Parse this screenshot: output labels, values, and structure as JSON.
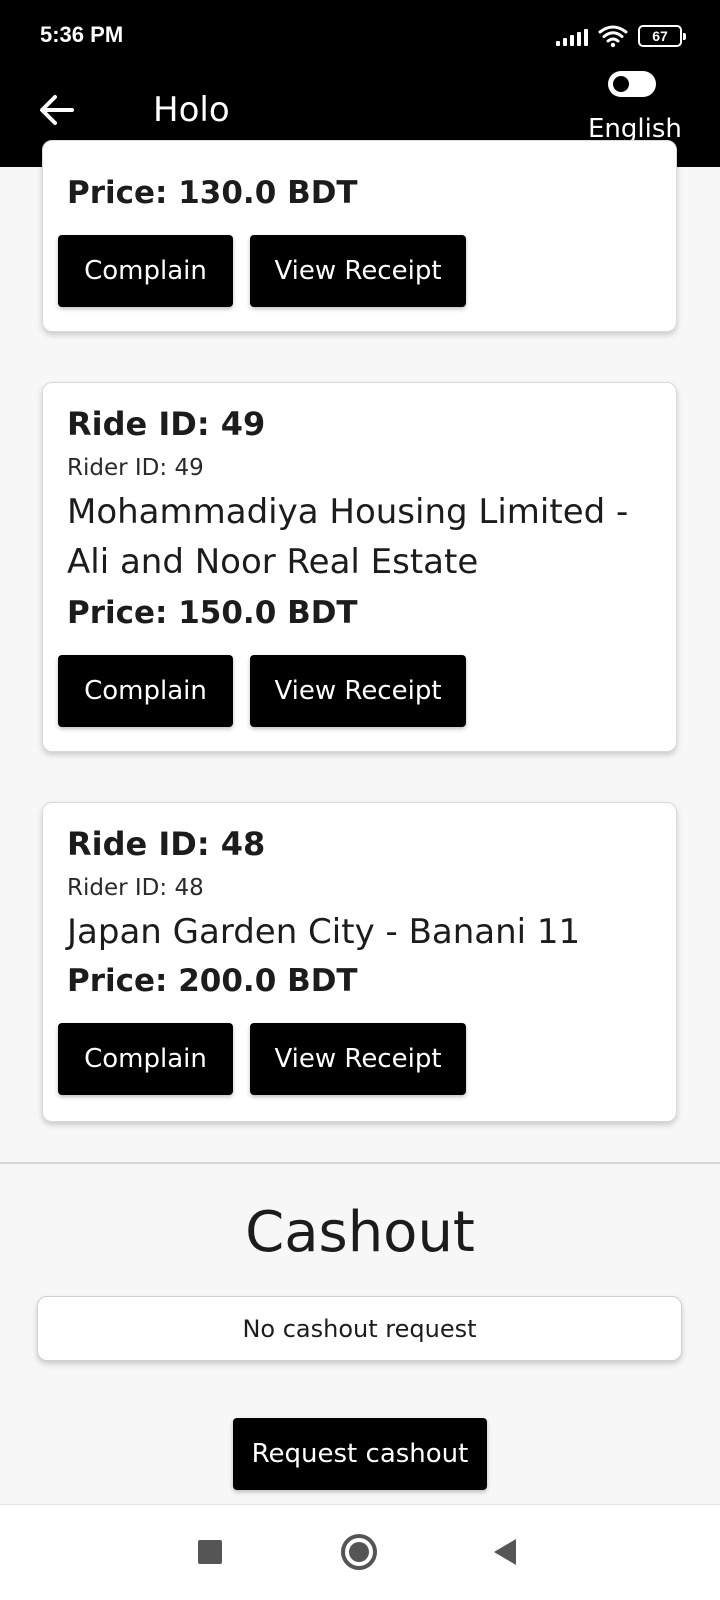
{
  "status_bar": {
    "time": "5:36 PM",
    "battery": "67",
    "icons": [
      "signal-icon",
      "wifi-icon",
      "battery-icon"
    ]
  },
  "app_bar": {
    "title": "Holo",
    "back_icon": "arrow-left-icon",
    "language_label": "English",
    "toggle_on": false
  },
  "rides": [
    {
      "ride_id": "",
      "rider_id": "",
      "route": "",
      "price": "Price: 130.0 BDT",
      "complain_label": "Complain",
      "receipt_label": "View Receipt"
    },
    {
      "ride_id": "Ride ID: 49",
      "rider_id": "Rider ID: 49",
      "route": "Mohammadiya Housing Limited - Ali and Noor Real Estate",
      "price": "Price: 150.0 BDT",
      "complain_label": "Complain",
      "receipt_label": "View Receipt"
    },
    {
      "ride_id": "Ride ID: 48",
      "rider_id": "Rider ID: 48",
      "route": "Japan Garden City - Banani 11",
      "price": "Price: 200.0 BDT",
      "complain_label": "Complain",
      "receipt_label": "View Receipt"
    }
  ],
  "cashout": {
    "title": "Cashout",
    "status": "No cashout request",
    "button_label": "Request cashout"
  },
  "nav_bar": {
    "icons": [
      "recent-apps-icon",
      "home-icon",
      "back-triangle-icon"
    ]
  },
  "colors": {
    "header_bg": "#000000",
    "button_bg": "#000000",
    "page_bg": "#f7f7f7",
    "card_bg": "#ffffff"
  }
}
